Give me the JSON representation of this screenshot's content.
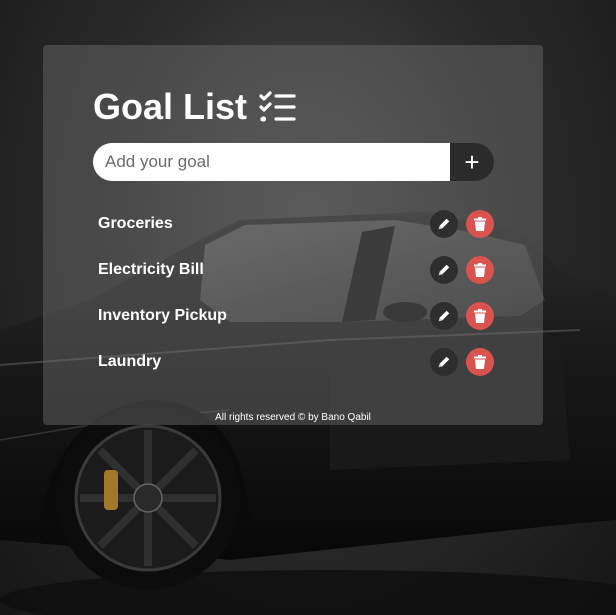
{
  "app": {
    "title": "Goal List",
    "title_icon": "checklist-icon"
  },
  "input": {
    "placeholder": "Add your goal",
    "value": "",
    "add_label": "+"
  },
  "goals": [
    {
      "label": "Groceries"
    },
    {
      "label": "Electricity Bill"
    },
    {
      "label": "Inventory Pickup"
    },
    {
      "label": "Laundry"
    }
  ],
  "icons": {
    "edit": "pencil-icon",
    "delete": "trash-icon"
  },
  "colors": {
    "delete_button": "#d9534f",
    "edit_button": "#2e2e2e",
    "add_button": "#2b2b2b",
    "card": "rgba(110,110,110,0.45)"
  },
  "footer": {
    "text": "All rights reserved © by Bano Qabil"
  }
}
